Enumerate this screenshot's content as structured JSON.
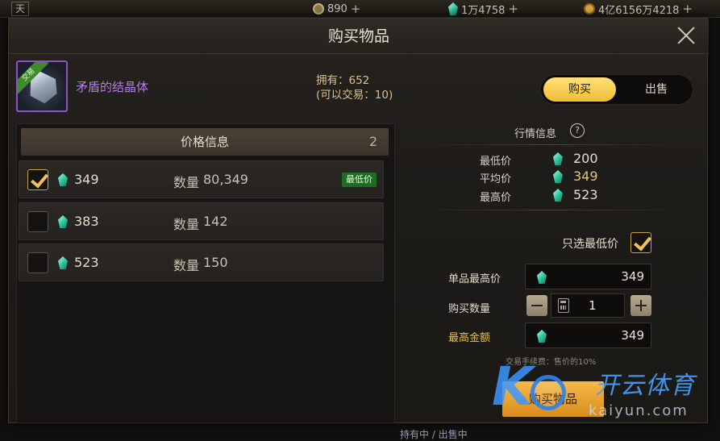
{
  "topbar": {
    "left_char": "天",
    "currencies": [
      {
        "icon": "c-coin-icon",
        "value": "890",
        "color": "#c9b27a"
      },
      {
        "icon": "gem-icon",
        "value": "1万4758",
        "color": "#3fcfa6"
      },
      {
        "icon": "gold-coin-icon",
        "value": "4亿6156万4218",
        "color": "#d6a43b"
      }
    ]
  },
  "modal": {
    "title": "购买物品",
    "item": {
      "name": "矛盾的结晶体",
      "tag": "交易",
      "owned": "拥有：652",
      "tradable": "(可以交易：10)"
    },
    "tabs": {
      "buy": "购买",
      "sell": "出售"
    },
    "price_list": {
      "header": "价格信息",
      "count": "2",
      "qty_label": "数量",
      "lowest_tag": "最低价",
      "rows": [
        {
          "price": "349",
          "qty": "80,349",
          "checked": true,
          "lowest": true
        },
        {
          "price": "383",
          "qty": "142",
          "checked": false,
          "lowest": false
        },
        {
          "price": "523",
          "qty": "150",
          "checked": false,
          "lowest": false
        }
      ]
    },
    "market": {
      "title": "行情信息",
      "help": "?",
      "min_label": "最低价",
      "min": "200",
      "avg_label": "平均价",
      "avg": "349",
      "max_label": "最高价",
      "max": "523"
    },
    "form": {
      "only_lowest": "只选最低价",
      "unit_max_label": "单品最高价",
      "unit_max": "349",
      "quantity_label": "购买数量",
      "quantity": "1",
      "total_label": "最高金额",
      "total": "349",
      "fee_note": "交易手续费：售价的10%",
      "buy_button": "购买物品"
    }
  },
  "watermark": {
    "cn": "开云体育",
    "en": "kaiyun.com"
  },
  "bottom": {
    "status": "持有中 / 出售中"
  }
}
